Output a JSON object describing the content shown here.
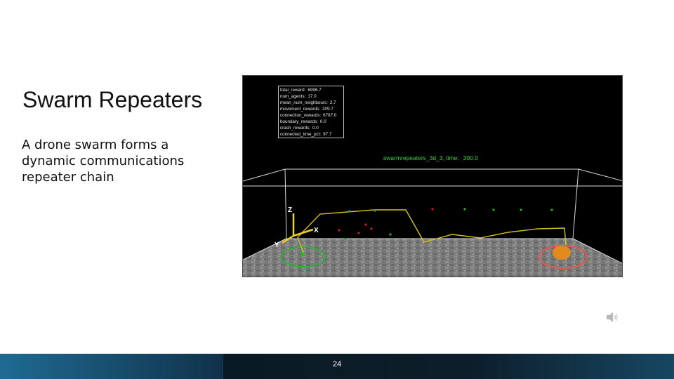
{
  "slide": {
    "title": "Swarm Repeaters",
    "body_lines": [
      "A drone swarm forms a",
      "dynamic communications",
      "repeater chain"
    ],
    "page_number": "24"
  },
  "simulation": {
    "stats": [
      {
        "label": "total_reward:",
        "value": "6996.7"
      },
      {
        "label": "num_agents:",
        "value": "17.0"
      },
      {
        "label": "mean_num_neighbours:",
        "value": "2.7"
      },
      {
        "label": "movement_rewards:",
        "value": "209.7"
      },
      {
        "label": "connection_rewards:",
        "value": "6787.0"
      },
      {
        "label": "boundary_rewards:",
        "value": "0.0"
      },
      {
        "label": "crash_rewards:",
        "value": "0.0"
      },
      {
        "label": "connected_time_pct:",
        "value": "97.7"
      }
    ],
    "caption_label": "swarmrepeaters_3d_3, time:",
    "caption_value": "390.0",
    "axes": {
      "x": "X",
      "y": "Y",
      "z": "Z"
    },
    "colors": {
      "chain": "#d4c21a",
      "agent_connected": "#22b02a",
      "agent_disconnected": "#c22222",
      "start_ring": "#2fae3c",
      "goal_ring": "#e45a4a",
      "axis": "#f0d020",
      "caption": "#3ecf3e"
    }
  },
  "icons": {
    "speaker": "speaker-icon"
  }
}
